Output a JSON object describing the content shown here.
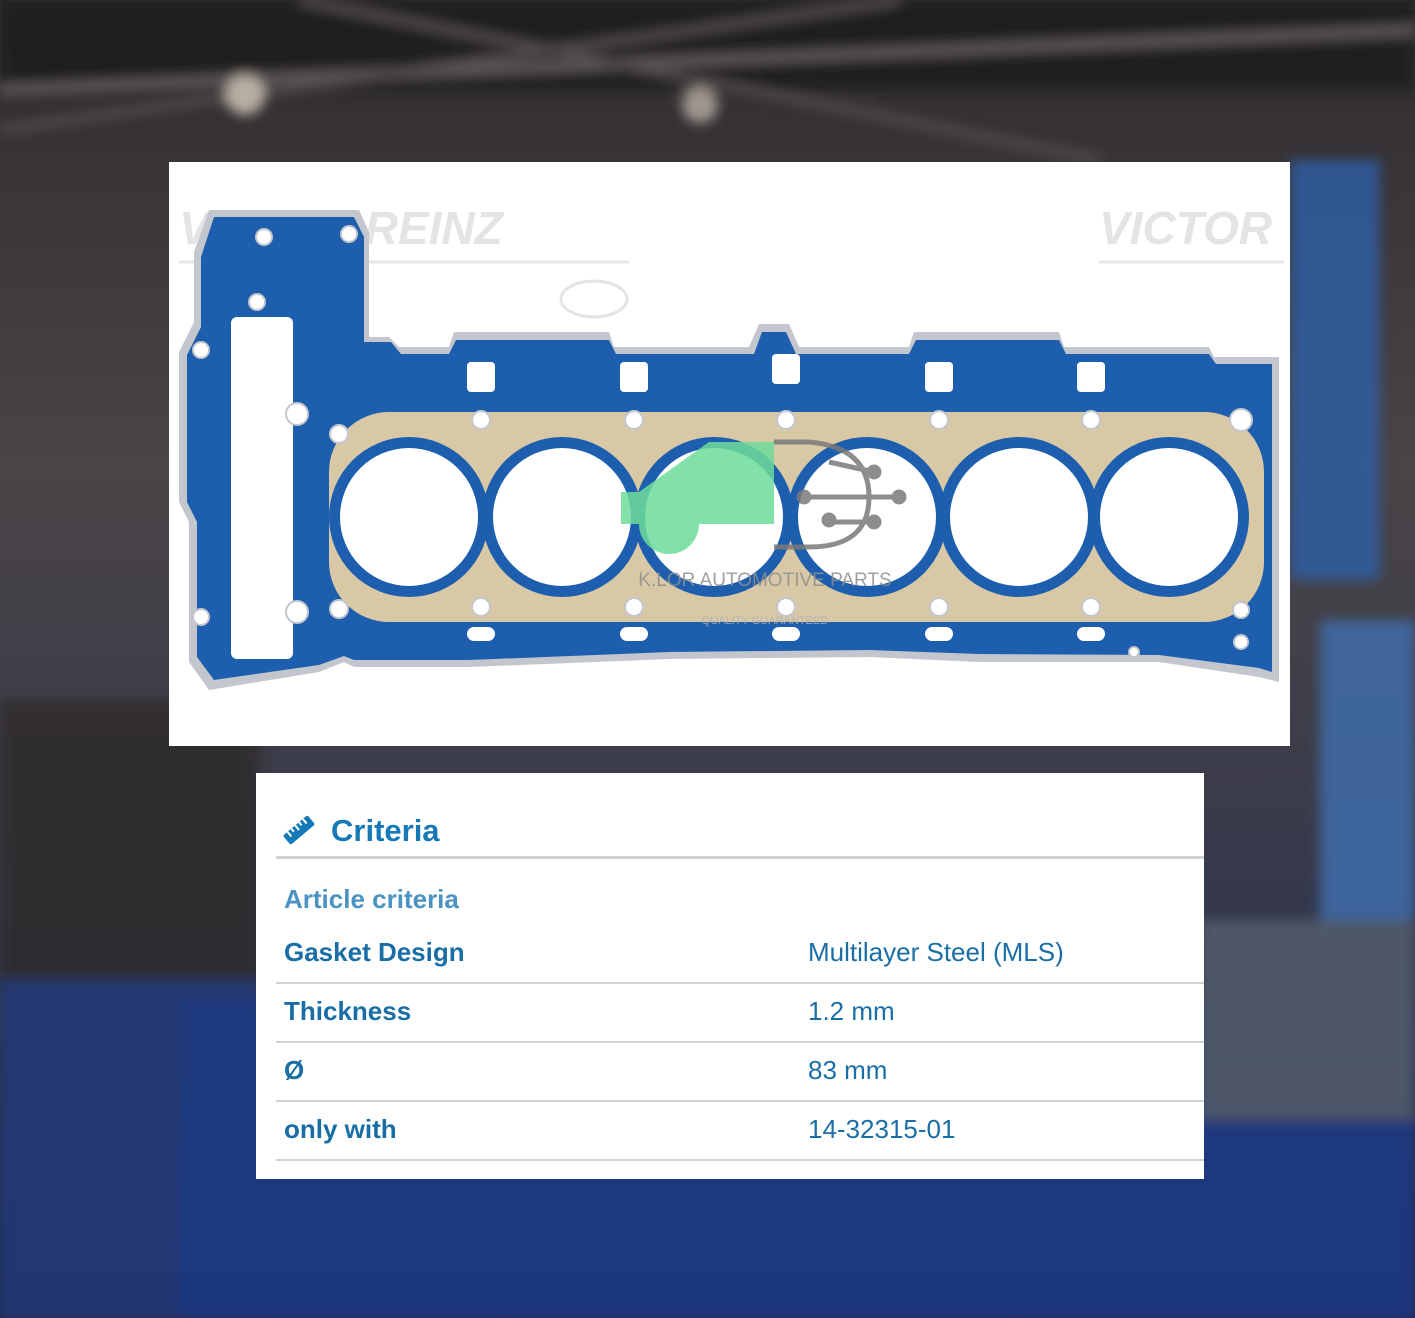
{
  "product_photo": {
    "brand_watermark": [
      "VICTOR REINZ",
      "VICTOR"
    ],
    "overlay_logo": {
      "company": "K.LOR AUTOMOTIVE PARTS",
      "tagline": "QUALITY GUARANTEED",
      "colors": {
        "car": "#6ddc9a",
        "circuit": "#7a7a7a"
      }
    },
    "colors": {
      "gasket_blue": "#1d5fae",
      "gasket_steel": "#d9c8a6",
      "outline_gray": "#c3c6cc"
    }
  },
  "criteria": {
    "icon": "ruler-icon",
    "title": "Criteria",
    "subtitle": "Article criteria",
    "rows": [
      {
        "label": "Gasket Design",
        "value": "Multilayer Steel (MLS)"
      },
      {
        "label": "Thickness",
        "value": "1.2 mm"
      },
      {
        "label": "Ø",
        "value": "83 mm"
      },
      {
        "label": "only with",
        "value": "14-32315-01"
      }
    ],
    "colors": {
      "accent": "#1479b6",
      "divider": "#cfd3d7"
    }
  }
}
